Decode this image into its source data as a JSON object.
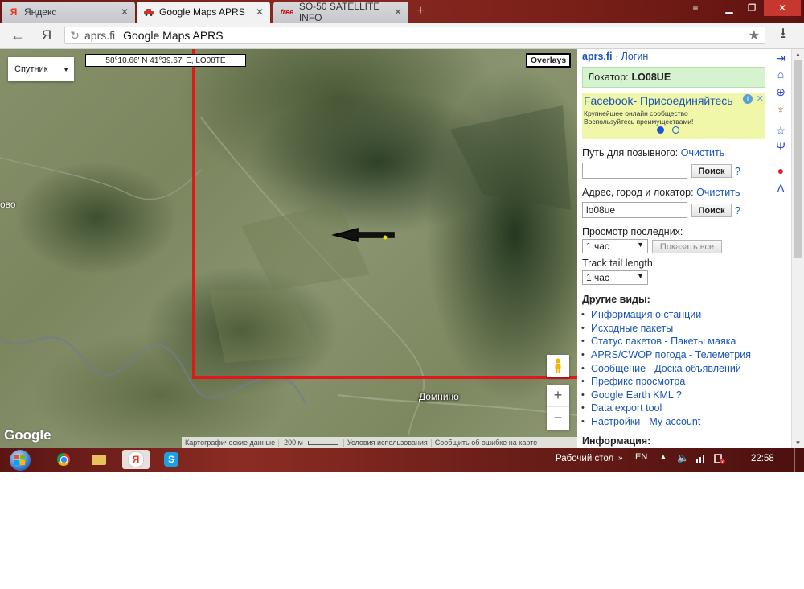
{
  "browser": {
    "tabs": [
      {
        "label": "Яндекс",
        "icon": "yandex-icon",
        "active": false
      },
      {
        "label": "Google Maps APRS",
        "icon": "car-icon",
        "active": true
      },
      {
        "label": "SO-50 SATELLITE INFO",
        "icon": "free-icon",
        "icon_text": "free",
        "active": false
      }
    ],
    "omnibox_domain": "aprs.fi",
    "omnibox_title": "Google Maps APRS",
    "back_glyph": "←",
    "yandex_glyph": "Я",
    "star_glyph": "★",
    "download_glyph": "⭳"
  },
  "map": {
    "type_selector": "Спутник",
    "coordinates": "58°10.66' N 41°39.67' E, LO08TE",
    "overlays_label": "Overlays",
    "village_label": "Домнино",
    "left_label": "ово",
    "google_logo": "Google",
    "zoom_in": "+",
    "zoom_out": "−",
    "footer": {
      "data": "Картографические данные",
      "scale": "200 м",
      "terms": "Условия использования",
      "report": "Сообщить об ошибке на карте"
    }
  },
  "sidebar": {
    "site": "aprs.fi",
    "separator": "·",
    "login": "Логин",
    "locator_label": "Локатор:",
    "locator_value": "LO08UE",
    "ad": {
      "title": "Facebook- Присоединяйтесь",
      "line1": "Крупнейшее онлайн сообщество",
      "line2": "Воспользуйтесь преимуществами!"
    },
    "callsign_path_label": "Путь для позывного:",
    "clear_label": "Очистить",
    "search_label": "Поиск",
    "help_label": "?",
    "callsign_value": "",
    "address_label": "Адрес, город и локатор:",
    "address_value": "lo08ue",
    "view_last_label": "Просмотр последних:",
    "view_last_value": "1 час",
    "show_all_label": "Показать все",
    "track_tail_label": "Track tail length:",
    "track_tail_value": "1 час",
    "other_views_title": "Другие виды:",
    "links": [
      "Информация о станции",
      "Исходные пакеты",
      "Статус пакетов - Пакеты маяка",
      "APRS/CWOP погода - Телеметрия",
      "Сообщение - Доска объявлений",
      "Префикс просмотра",
      "Google Earth KML ?",
      "Data export tool",
      "Настройки - My account"
    ],
    "info_title": "Информация:"
  },
  "taskbar": {
    "desktop_label": "Рабочий стол",
    "lang": "EN",
    "time": "22:58"
  }
}
